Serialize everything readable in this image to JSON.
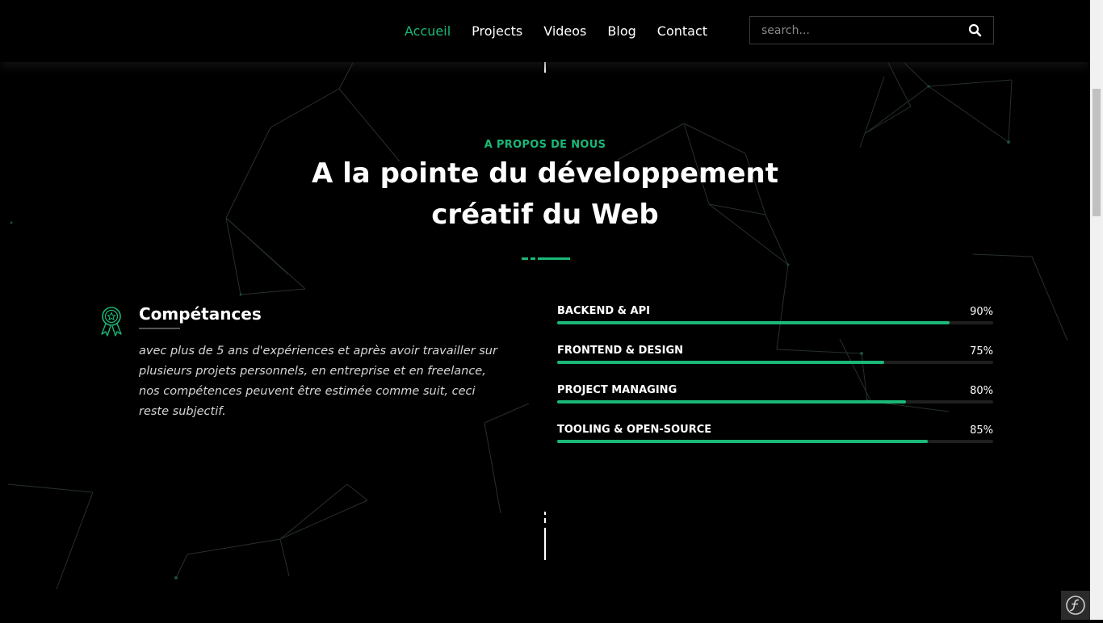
{
  "nav": {
    "items": [
      {
        "label": "Accueil",
        "active": true
      },
      {
        "label": "Projects",
        "active": false
      },
      {
        "label": "Videos",
        "active": false
      },
      {
        "label": "Blog",
        "active": false
      },
      {
        "label": "Contact",
        "active": false
      }
    ]
  },
  "search": {
    "placeholder": "search..."
  },
  "about": {
    "eyebrow": "A PROPOS DE NOUS",
    "title": "A la pointe du développement créatif du Web"
  },
  "skills": {
    "heading": "Compétances",
    "text": "avec plus de 5 ans d'expériences et après avoir travailler sur plusieurs projets personnels, en entreprise et en freelance, nos compétences peuvent être estimée comme suit, ceci reste subjectif.",
    "items": [
      {
        "name": "BACKEND & API",
        "percent_label": "90%",
        "value": 90
      },
      {
        "name": "FRONTEND & DESIGN",
        "percent_label": "75%",
        "value": 75
      },
      {
        "name": "PROJECT MANAGING",
        "percent_label": "80%",
        "value": 80
      },
      {
        "name": "TOOLING & OPEN-SOURCE",
        "percent_label": "85%",
        "value": 85
      }
    ]
  },
  "colors": {
    "accent": "#1bb877",
    "background": "#000000",
    "text": "#ffffff"
  },
  "icons": {
    "search": "search-icon",
    "award": "award-ribbon-icon",
    "toolbar": "symfony-logo-icon"
  }
}
